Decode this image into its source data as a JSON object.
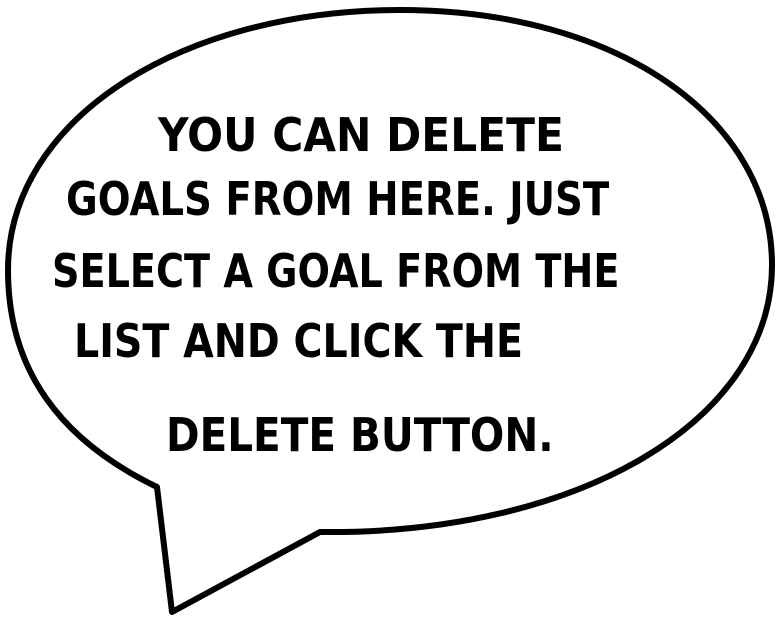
{
  "speech_bubble": {
    "lines": [
      "YOU CAN DELETE",
      "GOALS FROM HERE. JUST",
      "SELECT A GOAL FROM THE",
      "LIST AND CLICK THE",
      "DELETE BUTTON."
    ],
    "fill_color": "#ffffff",
    "outline_color": "#000000",
    "text_color": "#000000"
  }
}
